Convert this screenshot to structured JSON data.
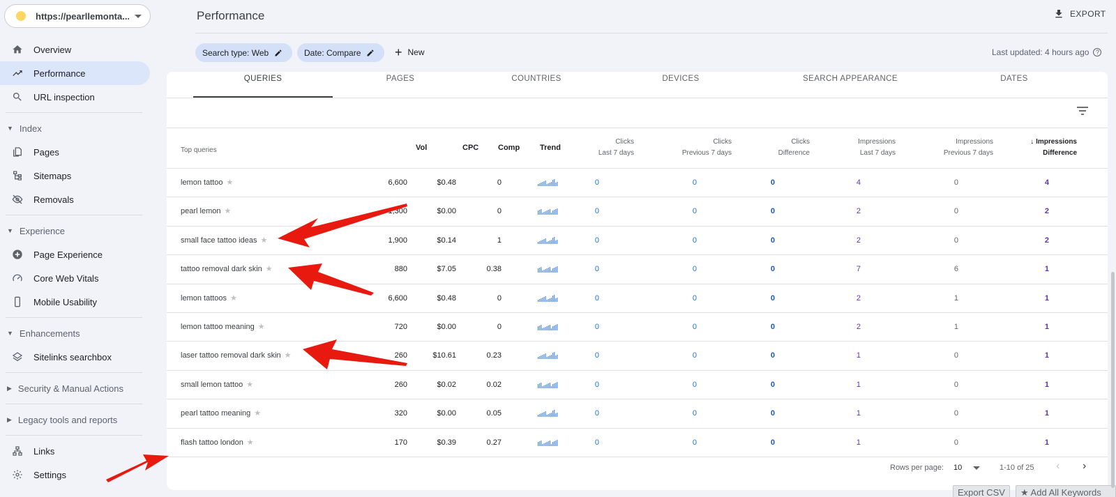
{
  "property": {
    "url": "https://pearllemonta..."
  },
  "sidebar": {
    "top": [
      {
        "label": "Overview",
        "icon": "home-icon"
      },
      {
        "label": "Performance",
        "icon": "trending-up-icon",
        "active": true
      },
      {
        "label": "URL inspection",
        "icon": "search-icon"
      }
    ],
    "index": {
      "title": "Index",
      "items": [
        "Pages",
        "Sitemaps",
        "Removals"
      ]
    },
    "experience": {
      "title": "Experience",
      "items": [
        "Page Experience",
        "Core Web Vitals",
        "Mobile Usability"
      ]
    },
    "enhancements": {
      "title": "Enhancements",
      "items": [
        "Sitelinks searchbox"
      ]
    },
    "security": "Security & Manual Actions",
    "legacy": "Legacy tools and reports",
    "bottom": [
      "Links",
      "Settings"
    ]
  },
  "header": {
    "title": "Performance",
    "export": "EXPORT",
    "chip_search": "Search type: Web",
    "chip_date": "Date: Compare",
    "new": "New",
    "last_updated": "Last updated: 4 hours ago"
  },
  "tabs": [
    "QUERIES",
    "PAGES",
    "COUNTRIES",
    "DEVICES",
    "SEARCH APPEARANCE",
    "DATES"
  ],
  "table": {
    "headers": {
      "query": "Top queries",
      "vol": "Vol",
      "cpc": "CPC",
      "comp": "Comp",
      "trend": "Trend",
      "clicks_last_1": "Clicks",
      "clicks_last_2": "Last 7 days",
      "clicks_prev_1": "Clicks",
      "clicks_prev_2": "Previous 7 days",
      "clicks_diff_1": "Clicks",
      "clicks_diff_2": "Difference",
      "impr_last_1": "Impressions",
      "impr_last_2": "Last 7 days",
      "impr_prev_1": "Impressions",
      "impr_prev_2": "Previous 7 days",
      "impr_diff_1": "Impressions",
      "impr_diff_2": "Difference"
    },
    "rows": [
      {
        "query": "lemon tattoo",
        "vol": "6,600",
        "cpc": "$0.48",
        "comp": "0",
        "cl": "0",
        "cp": "0",
        "cd": "0",
        "il": "4",
        "ip": "0",
        "id": "4"
      },
      {
        "query": "pearl lemon",
        "vol": "1,300",
        "cpc": "$0.00",
        "comp": "0",
        "cl": "0",
        "cp": "0",
        "cd": "0",
        "il": "2",
        "ip": "0",
        "id": "2"
      },
      {
        "query": "small face tattoo ideas",
        "vol": "1,900",
        "cpc": "$0.14",
        "comp": "1",
        "cl": "0",
        "cp": "0",
        "cd": "0",
        "il": "2",
        "ip": "0",
        "id": "2"
      },
      {
        "query": "tattoo removal dark skin",
        "vol": "880",
        "cpc": "$7.05",
        "comp": "0.38",
        "cl": "0",
        "cp": "0",
        "cd": "0",
        "il": "7",
        "ip": "6",
        "id": "1"
      },
      {
        "query": "lemon tattoos",
        "vol": "6,600",
        "cpc": "$0.48",
        "comp": "0",
        "cl": "0",
        "cp": "0",
        "cd": "0",
        "il": "2",
        "ip": "1",
        "id": "1"
      },
      {
        "query": "lemon tattoo meaning",
        "vol": "720",
        "cpc": "$0.00",
        "comp": "0",
        "cl": "0",
        "cp": "0",
        "cd": "0",
        "il": "2",
        "ip": "1",
        "id": "1"
      },
      {
        "query": "laser tattoo removal dark skin",
        "vol": "260",
        "cpc": "$10.61",
        "comp": "0.23",
        "cl": "0",
        "cp": "0",
        "cd": "0",
        "il": "1",
        "ip": "0",
        "id": "1"
      },
      {
        "query": "small lemon tattoo",
        "vol": "260",
        "cpc": "$0.02",
        "comp": "0.02",
        "cl": "0",
        "cp": "0",
        "cd": "0",
        "il": "1",
        "ip": "0",
        "id": "1"
      },
      {
        "query": "pearl tattoo meaning",
        "vol": "320",
        "cpc": "$0.00",
        "comp": "0.05",
        "cl": "0",
        "cp": "0",
        "cd": "0",
        "il": "1",
        "ip": "0",
        "id": "1"
      },
      {
        "query": "flash tattoo london",
        "vol": "170",
        "cpc": "$0.39",
        "comp": "0.27",
        "cl": "0",
        "cp": "0",
        "cd": "0",
        "il": "1",
        "ip": "0",
        "id": "1"
      }
    ]
  },
  "footer": {
    "rows_label": "Rows per page:",
    "rows_value": "10",
    "range": "1-10 of 25"
  },
  "bottom_buttons": {
    "export_csv": "Export CSV",
    "add_all": "★ Add All Keywords"
  },
  "colors": {
    "accent": "#1a73e8",
    "active_nav": "#dbe6fb",
    "chip": "#d3e0f8",
    "arrow": "#e8190f",
    "impressions": "#5e35b1"
  }
}
